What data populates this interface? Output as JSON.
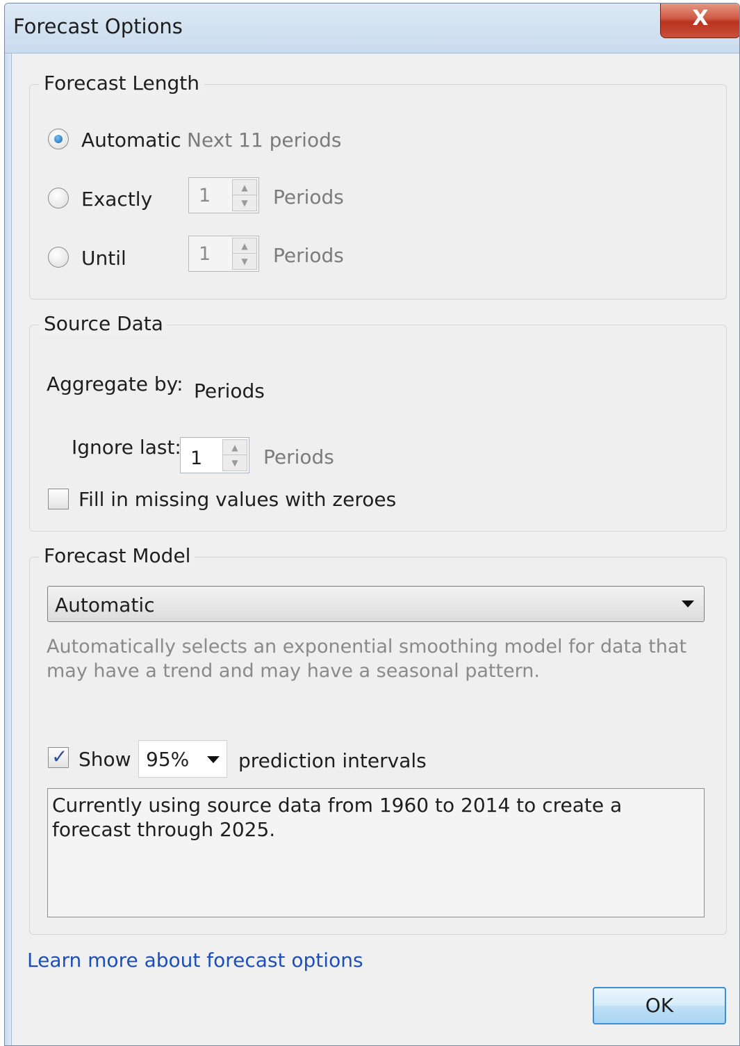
{
  "window": {
    "title": "Forecast Options",
    "close_label": "X"
  },
  "forecast_length": {
    "legend": "Forecast Length",
    "options": [
      {
        "label": "Automatic",
        "hint": "Next 11 periods",
        "selected": true
      },
      {
        "label": "Exactly",
        "value": "1",
        "unit": "Periods",
        "selected": false
      },
      {
        "label": "Until",
        "value": "1",
        "unit": "Periods",
        "selected": false
      }
    ]
  },
  "source_data": {
    "legend": "Source Data",
    "aggregate_label": "Aggregate by:",
    "aggregate_value": "Periods",
    "ignore_last_label": "Ignore last:",
    "ignore_last_value": "1",
    "ignore_last_unit": "Periods",
    "fill_missing_label": "Fill in missing values with zeroes",
    "fill_missing_checked": false
  },
  "forecast_model": {
    "legend": "Forecast Model",
    "selected": "Automatic",
    "description": "Automatically selects an exponential smoothing model for data that may have a trend and may have a seasonal pattern.",
    "show_label": "Show",
    "show_checked": true,
    "interval_value": "95%",
    "interval_suffix": "prediction intervals",
    "summary": "Currently using source data from 1960 to 2014 to create a forecast through 2025."
  },
  "footer": {
    "learn_more": "Learn more about forecast options",
    "ok_label": "OK"
  }
}
